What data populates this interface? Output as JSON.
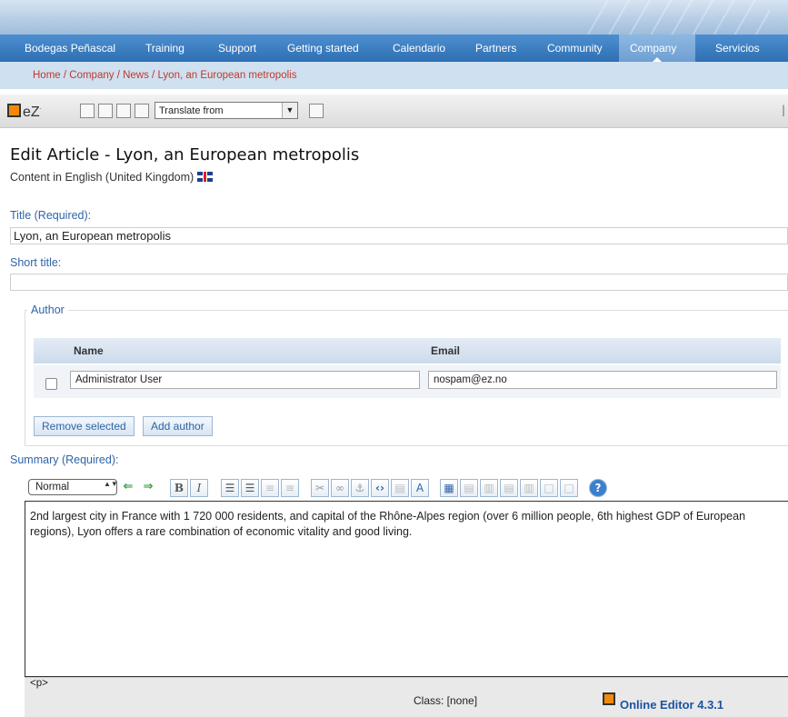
{
  "menu": {
    "items": [
      {
        "label": "Bodegas Peñascal",
        "active": false
      },
      {
        "label": "Training",
        "active": false
      },
      {
        "label": "Support",
        "active": false
      },
      {
        "label": "Getting started",
        "active": false
      },
      {
        "label": "Calendario",
        "active": false
      },
      {
        "label": "Partners",
        "active": false
      },
      {
        "label": "Community",
        "active": false
      },
      {
        "label": "Company",
        "active": true
      },
      {
        "label": "Servicios",
        "active": false
      }
    ]
  },
  "breadcrumb": {
    "home": "Home",
    "company": "Company",
    "news": "News",
    "current": "Lyon, an European metropolis",
    "separator": " / "
  },
  "ez_toolbar": {
    "logo": "eZ",
    "logo_mark": "·",
    "translate_placeholder": "Translate from",
    "translate_arrow": "▼"
  },
  "page": {
    "title": "Edit Article - Lyon, an European metropolis",
    "language_label": "Content in English (United Kingdom)"
  },
  "form": {
    "title_label": "Title (Required):",
    "title_value": "Lyon, an European metropolis",
    "short_title_label": "Short title:",
    "short_title_value": "",
    "author_legend": "Author",
    "author_table": {
      "col_name": "Name",
      "col_email": "Email",
      "rows": [
        {
          "name": "Administrator User",
          "email": "nospam@ez.no",
          "checked": false
        }
      ]
    },
    "remove_selected_label": "Remove selected",
    "add_author_label": "Add author",
    "summary_label": "Summary (Required):"
  },
  "editor": {
    "style_value": "Normal",
    "spin_glyph": "▲▼",
    "buttons": {
      "outdent": "⇐",
      "indent": "⇒",
      "bold": "B",
      "italic": "I",
      "ordered_list": "☰",
      "unordered_list": "☰",
      "link": "✂",
      "anchor": "⚓",
      "literal": "‹›",
      "help": "?"
    },
    "content": "2nd largest city in France with 1 720 000 residents, and capital of the Rhône-Alpes region (over 6 million people, 6th highest GDP of European regions), Lyon offers a rare combination of economic vitality and good living.",
    "path": "<p>",
    "class_label": "Class: [none]",
    "version": "Online Editor 4.3.1"
  },
  "colors": {
    "menu_blue": "#2f6fb3",
    "link_blue": "#2f65a8",
    "breadcrumb_red": "#c0392b",
    "logo_orange": "#f08a0e"
  }
}
